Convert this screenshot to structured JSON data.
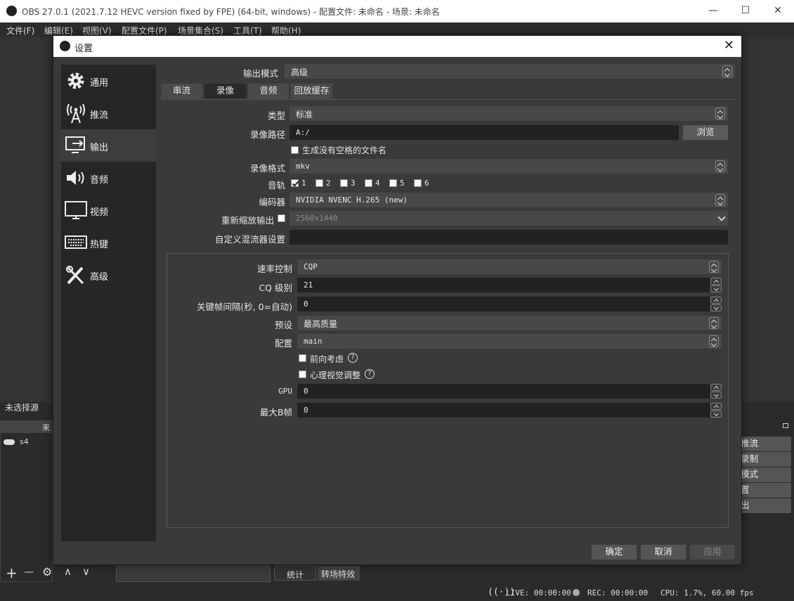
{
  "window": {
    "title": "OBS 27.0.1 (2021.7.12 HEVC version fixed by FPE) (64-bit, windows) - 配置文件: 未命名 - 场景: 未命名",
    "minimize": "—",
    "maximize": "☐",
    "close": "✕"
  },
  "menu": [
    "文件(F)",
    "编辑(E)",
    "视图(V)",
    "配置文件(P)",
    "场景集合(S)",
    "工具(T)",
    "帮助(H)"
  ],
  "background": {
    "no_source": "未选择源",
    "sources_header": "来",
    "source_item": "s4",
    "right_controls": [
      "推流",
      "录制",
      "模式",
      "置",
      "出"
    ],
    "toolbar_symbols": [
      "+",
      "—",
      "⚙",
      "∧",
      "∨"
    ],
    "mixer_tabs": [
      "统计",
      "转场特效"
    ]
  },
  "status": {
    "live": "LIVE: 00:00:00",
    "rec": "REC: 00:00:00",
    "cpu": "CPU: 1.7%, 60.00 fps"
  },
  "dialog": {
    "title": "设置",
    "nav": [
      "通用",
      "推流",
      "输出",
      "音频",
      "视频",
      "热键",
      "高级"
    ],
    "output_mode_label": "输出模式",
    "output_mode_value": "高级",
    "tabs": [
      "串流",
      "录像",
      "音频",
      "回放缓存"
    ],
    "recording": {
      "type_label": "类型",
      "type_value": "标准",
      "path_label": "录像路径",
      "path_value": "A:/",
      "browse": "浏览",
      "no_space_label": "生成没有空格的文件名",
      "format_label": "录像格式",
      "format_value": "mkv",
      "tracks_label": "音轨",
      "tracks": [
        "1",
        "2",
        "3",
        "4",
        "5",
        "6"
      ],
      "encoder_label": "编码器",
      "encoder_value": "NVIDIA NVENC H.265 (new)",
      "rescale_label": "重新缩放输出",
      "rescale_value": "2560x1440",
      "muxer_label": "自定义混流器设置",
      "muxer_value": ""
    },
    "encoder_settings": {
      "rate_control_label": "速率控制",
      "rate_control_value": "CQP",
      "cq_label": "CQ 级别",
      "cq_value": "21",
      "keyframe_label": "关键帧间隔(秒, 0=自动)",
      "keyframe_value": "0",
      "preset_label": "预设",
      "preset_value": "最高质量",
      "profile_label": "配置",
      "profile_value": "main",
      "lookahead_label": "前向考虑",
      "psycho_label": "心理视觉调整",
      "gpu_label": "GPU",
      "gpu_value": "0",
      "bframes_label": "最大B帧",
      "bframes_value": "0",
      "help_glyph": "?"
    },
    "buttons": {
      "ok": "确定",
      "cancel": "取消",
      "apply": "应用"
    }
  }
}
